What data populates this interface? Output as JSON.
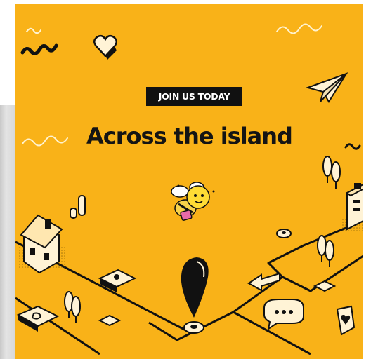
{
  "banner": {
    "tagline": "JOIN US TODAY",
    "headline": "Across the island"
  },
  "icons": [
    "heart-icon",
    "paper-plane-icon",
    "bee-mascot-icon",
    "house-icon",
    "building-icon",
    "location-pin-icon",
    "chat-bubble-icon",
    "arrow-sign-icon",
    "tree-icon",
    "coin-stack-icon"
  ],
  "colors": {
    "background": "#f9b218",
    "ink": "#141414",
    "light_panel": "#ffffff",
    "accent_pink": "#e86aa8"
  }
}
